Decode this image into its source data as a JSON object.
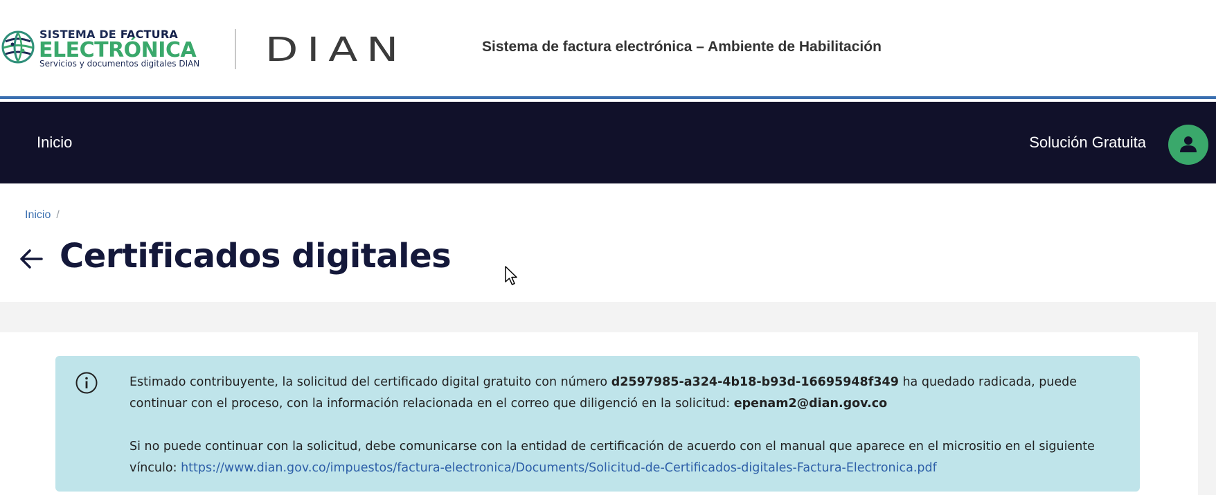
{
  "header": {
    "logo": {
      "line1_prefix": "SISTEMA DE ",
      "line1_bold": "FACTURA",
      "line2": "ELECTRÓNICA",
      "line3": "Servicios y documentos digitales DIAN"
    },
    "dian_logo_text": "DIAN",
    "system_title": "Sistema de factura electrónica – Ambiente de Habilitación"
  },
  "nav": {
    "home_label": "Inicio",
    "solution_label": "Solución Gratuita",
    "avatar_icon": "user-icon"
  },
  "breadcrumb": {
    "items": [
      "Inicio"
    ],
    "separator": "/"
  },
  "page": {
    "title": "Certificados digitales",
    "back_icon": "arrow-left-icon"
  },
  "alert": {
    "icon": "info-icon",
    "p1_part1": "Estimado contribuyente, la solicitud del certificado digital gratuito con número ",
    "request_id": "d2597985-a324-4b18-b93d-16695948f349",
    "p1_part2": " ha quedado radicada, puede continuar con el proceso, con la información relacionada en el correo que diligenció en la solicitud: ",
    "email": "epenam2@dian.gov.co",
    "p2_text": "Si no puede continuar con la solicitud, debe comunicarse con la entidad de certificación de acuerdo con el manual que aparece en el micrositio en el siguiente vínculo: ",
    "link": "https://www.dian.gov.co/impuestos/factura-electronica/Documents/Solicitud-de-Certificados-digitales-Factura-Electronica.pdf"
  },
  "colors": {
    "nav_bg": "#11112a",
    "accent_green": "#3aa86b",
    "link_blue": "#2d5fa8",
    "alert_bg": "#bfe4ea",
    "header_border": "#3a6fb0"
  }
}
